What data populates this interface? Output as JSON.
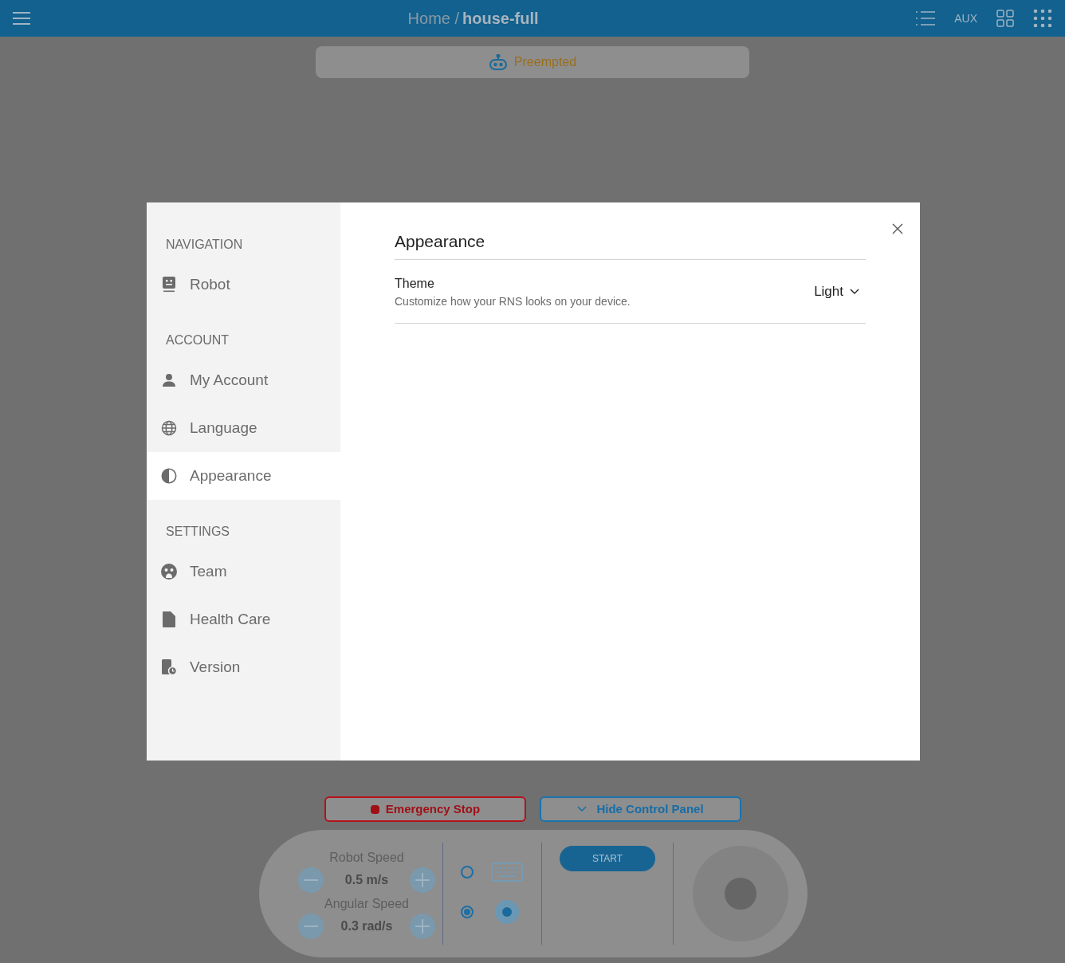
{
  "header": {
    "breadcrumb_parent": "Home /",
    "breadcrumb_current": "house-full",
    "aux_label": "AUX"
  },
  "status": {
    "label": "Preempted"
  },
  "settings_dialog": {
    "sidebar": [
      {
        "heading": "NAVIGATION",
        "items": [
          {
            "label": "Robot",
            "kind": "robot",
            "selected": false
          }
        ]
      },
      {
        "heading": "ACCOUNT",
        "items": [
          {
            "label": "My Account",
            "kind": "person",
            "selected": false
          },
          {
            "label": "Language",
            "kind": "globe",
            "selected": false
          },
          {
            "label": "Appearance",
            "kind": "contrast",
            "selected": true
          }
        ]
      },
      {
        "heading": "SETTINGS",
        "items": [
          {
            "label": "Team",
            "kind": "team",
            "selected": false
          },
          {
            "label": "Health Care",
            "kind": "document",
            "selected": false
          },
          {
            "label": "Version",
            "kind": "version",
            "selected": false
          }
        ]
      }
    ],
    "title": "Appearance",
    "rows": [
      {
        "label": "Theme",
        "description": "Customize how your RNS looks on your device.",
        "value": "Light"
      }
    ]
  },
  "control_panel": {
    "emergency_stop": "Emergency Stop",
    "hide_panel": "Hide Control Panel",
    "speeds": [
      {
        "label": "Robot Speed",
        "value": "0.5 m/s"
      },
      {
        "label": "Angular Speed",
        "value": "0.3 rad/s"
      }
    ],
    "drive_modes": [
      {
        "kind": "keyboard",
        "selected": false
      },
      {
        "kind": "joystick",
        "selected": true
      }
    ],
    "start": "START"
  }
}
